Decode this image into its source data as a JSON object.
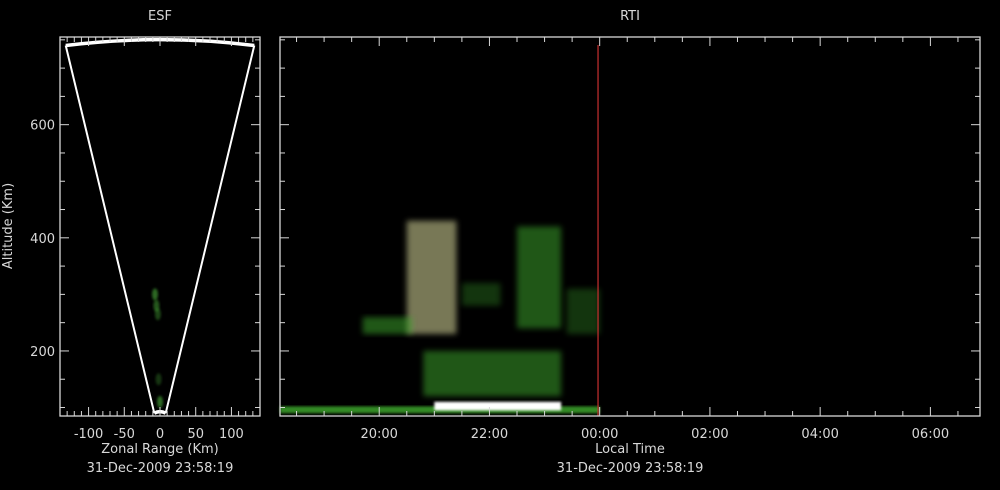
{
  "chart_data": [
    {
      "type": "scatter",
      "title": "ESF",
      "xlabel": "Zonal Range (Km)",
      "ylabel": "Altitude (Km)",
      "footer": "31-Dec-2009 23:58:19",
      "xlim": [
        -140,
        140
      ],
      "ylim": [
        85,
        755
      ],
      "xticks": [
        -100,
        -50,
        0,
        50,
        100
      ],
      "xtick_labels": [
        "-100",
        "-50",
        "0",
        "50",
        "100"
      ],
      "yticks": [
        200,
        400,
        600
      ],
      "ytick_labels": [
        "200",
        "400",
        "600"
      ],
      "fan": {
        "apex_x": 0,
        "apex_alt": 90,
        "left_top_x": -132,
        "right_top_x": 132,
        "top_alt": 740,
        "center_top_alt": 750
      },
      "echoes": [
        {
          "x": -7,
          "alt": 300,
          "intensity": 0.6
        },
        {
          "x": -5,
          "alt": 280,
          "intensity": 0.5
        },
        {
          "x": -3,
          "alt": 265,
          "intensity": 0.4
        },
        {
          "x": 0,
          "alt": 110,
          "intensity": 0.6
        },
        {
          "x": -2,
          "alt": 150,
          "intensity": 0.3
        }
      ],
      "colors": {
        "axes": "#d8d8d8",
        "fan": "#ffffff",
        "echo": "#4caf3a"
      }
    },
    {
      "type": "heatmap",
      "title": "RTI",
      "xlabel": "Local Time",
      "footer": "31-Dec-2009 23:58:19",
      "xlim_hours": [
        18.2,
        30.9
      ],
      "ylim": [
        85,
        755
      ],
      "xticks_hours": [
        20,
        22,
        24,
        26,
        28,
        30
      ],
      "xtick_labels": [
        "20:00",
        "22:00",
        "00:00",
        "02:00",
        "04:00",
        "06:00"
      ],
      "yticks": [
        200,
        400,
        600
      ],
      "current_time_hours": 23.97,
      "echo_regions": [
        {
          "t0": 18.2,
          "t1": 24.0,
          "alt0": 90,
          "alt1": 102,
          "intensity": 0.8
        },
        {
          "t0": 21.0,
          "t1": 23.3,
          "alt0": 95,
          "alt1": 110,
          "intensity": 1.0
        },
        {
          "t0": 20.8,
          "t1": 23.3,
          "alt0": 120,
          "alt1": 200,
          "intensity": 0.5
        },
        {
          "t0": 20.5,
          "t1": 21.4,
          "alt0": 230,
          "alt1": 430,
          "intensity": 0.6
        },
        {
          "t0": 19.7,
          "t1": 20.6,
          "alt0": 230,
          "alt1": 260,
          "intensity": 0.5
        },
        {
          "t0": 22.5,
          "t1": 23.3,
          "alt0": 240,
          "alt1": 420,
          "intensity": 0.5
        },
        {
          "t0": 21.5,
          "t1": 22.2,
          "alt0": 280,
          "alt1": 320,
          "intensity": 0.3
        },
        {
          "t0": 23.4,
          "t1": 24.0,
          "alt0": 230,
          "alt1": 310,
          "intensity": 0.3
        }
      ],
      "colors": {
        "axes": "#d8d8d8",
        "echo": "#3fae2f",
        "strong": "#ffffff",
        "bloom": "#c8c890",
        "marker": "#c83030"
      }
    }
  ],
  "shared_ylabel": "Altitude (Km)"
}
